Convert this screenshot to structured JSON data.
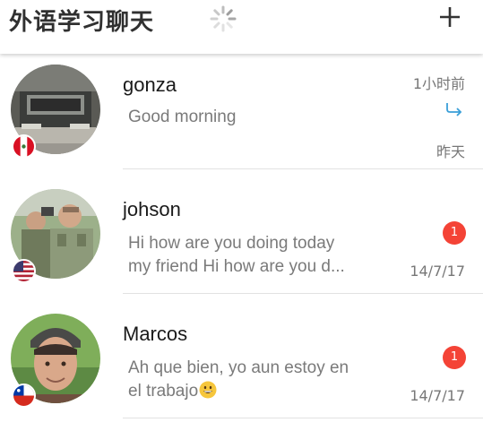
{
  "header": {
    "title": "外语学习聊天",
    "add_icon": "plus-icon",
    "loading_icon": "spinner-icon"
  },
  "chats": [
    {
      "name": "gonza",
      "preview": "Good morning",
      "time_top": "1小时前",
      "time_bottom": "昨天",
      "status_icon": "reply-arrow-icon",
      "flag": "peru"
    },
    {
      "name": "johson",
      "preview_line1": "Hi how are you doing today",
      "preview_line2": "my friend Hi how are you d...",
      "time": "14/7/17",
      "unread": "1",
      "flag": "usa"
    },
    {
      "name": "Marcos",
      "preview_line1": "Ah que bien, yo aun estoy en",
      "preview_line2": "el trabajo",
      "time": "14/7/17",
      "unread": "1",
      "emoji": "grinning-face",
      "flag": "chile"
    }
  ],
  "colors": {
    "badge": "#f44336",
    "reply_icon": "#3a9fd8",
    "header_text": "#303030",
    "preview_text": "#7a7a7a"
  }
}
